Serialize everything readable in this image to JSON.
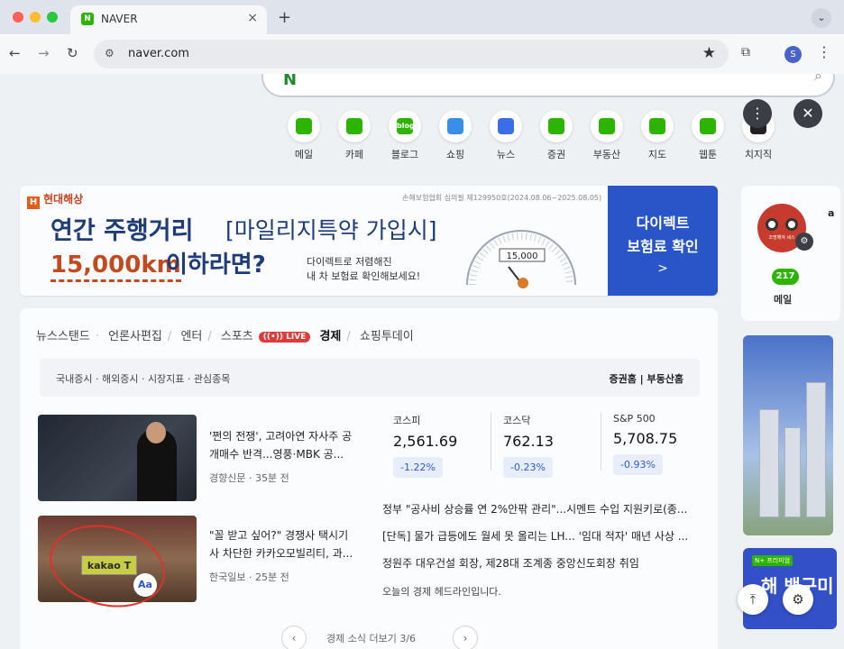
{
  "browser": {
    "tab_title": "NAVER",
    "tab_favicon": "N",
    "tab_close": "×",
    "new_tab": "+",
    "tab_menu": "⌄",
    "url": "naver.com",
    "profile_initial": "S"
  },
  "services": [
    {
      "label": "메일",
      "icon": "mail-icon",
      "color": "#2db400",
      "glyph": ""
    },
    {
      "label": "카페",
      "icon": "cafe-icon",
      "color": "#2db400",
      "glyph": ""
    },
    {
      "label": "블로그",
      "icon": "blog-icon",
      "color": "#2db400",
      "glyph": "blog"
    },
    {
      "label": "쇼핑",
      "icon": "shopping-icon",
      "color": "#3a8ee6",
      "glyph": ""
    },
    {
      "label": "뉴스",
      "icon": "news-icon",
      "color": "#3a6ee6",
      "glyph": ""
    },
    {
      "label": "증권",
      "icon": "stock-icon",
      "color": "#2db400",
      "glyph": ""
    },
    {
      "label": "부동산",
      "icon": "realestate-icon",
      "color": "#2db400",
      "glyph": ""
    },
    {
      "label": "지도",
      "icon": "map-icon",
      "color": "#2db400",
      "glyph": ""
    },
    {
      "label": "웹툰",
      "icon": "webtoon-icon",
      "color": "#2db400",
      "glyph": ""
    },
    {
      "label": "치지직",
      "icon": "chzzk-icon",
      "color": "#222222",
      "glyph": ""
    }
  ],
  "ad": {
    "brand": "현대해상",
    "brand_mark": "H",
    "disclaimer": "손해보험협회 심의필 제129950호(2024.08.06~2025.08.05)",
    "headline_bold": "연간 주행거리",
    "headline_light": "[마일리지특약 가입시]",
    "km": "15,000km",
    "km_suffix": "이하라면?",
    "sub1": "다이렉트로 저렴해진",
    "sub2": "내 차 보험료 확인해보세요!",
    "gauge_readout": "15,000",
    "cta_line1": "다이렉트",
    "cta_line2": "보험료 확인",
    "cta_arrow": ">"
  },
  "profile_card": {
    "mail_count": "217",
    "mail_label": "메일",
    "extra_letter": "a",
    "avatar_text": "조명해져 세스"
  },
  "right_ad2": {
    "tag": "N+ 프리미엄",
    "text": "해 뱃구미"
  },
  "news": {
    "tabs": [
      {
        "label": "뉴스스탠드",
        "active": false
      },
      {
        "label": "언론사편집",
        "active": false
      },
      {
        "label": "엔터",
        "active": false
      },
      {
        "label": "스포츠",
        "active": false
      },
      {
        "label": "경제",
        "active": true
      },
      {
        "label": "쇼핑투데이",
        "active": false
      }
    ],
    "live_badge": "((•)) LIVE",
    "subtabs_left": "국내증시 · 해외증시 · 시장지표 · 관심종목",
    "subtabs_right": "증권홈  |  부동산홈",
    "articles": [
      {
        "headline": "'쩐의 전쟁', 고려아연 자사주 공개매수 반격...영풍·MBK 공...",
        "source": "경향신문",
        "time": "35분 전"
      },
      {
        "headline": "\"꼴 받고 싶어?\" 경쟁사 택시기사 차단한 카카오모빌리티, 과...",
        "source": "한국일보",
        "time": "25분 전"
      }
    ],
    "kakao_sign": "kakao T",
    "aa_badge": "Aa",
    "stocks": [
      {
        "name": "코스피",
        "value": "2,561.69",
        "change": "-1.22%"
      },
      {
        "name": "코스닥",
        "value": "762.13",
        "change": "-0.23%"
      },
      {
        "name": "S&P 500",
        "value": "5,708.75",
        "change": "-0.93%"
      }
    ],
    "headlines": [
      "정부 \"공사비 상승률 연 2%안팎 관리\"...시멘트 수입 지원키로(종...",
      "[단독] 물가 급등에도 월세 못 올리는 LH... '임대 적자' 매년 사상 ...",
      "정원주 대우건설 회장, 제28대 조계종 중앙신도회장 취임"
    ],
    "footer": "오늘의 경제 헤드라인입니다.",
    "pager_text": "경제 소식 더보기 3/6"
  }
}
